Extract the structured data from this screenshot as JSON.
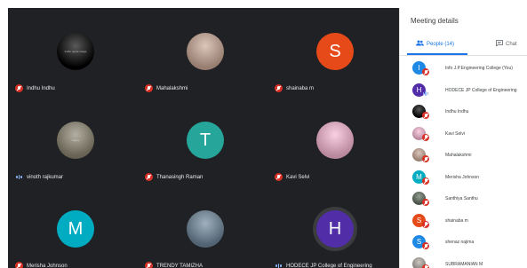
{
  "grid": {
    "tiles": [
      {
        "name": "Indhu Indhu",
        "status": "muted",
        "avatar": {
          "type": "image",
          "bg": "#000000",
          "tiny_text": "Indhu quote image"
        }
      },
      {
        "name": "Mahalakshmi",
        "status": "muted",
        "avatar": {
          "type": "image",
          "bg": "#c9a896"
        }
      },
      {
        "name": "shainaba m",
        "status": "muted",
        "avatar": {
          "type": "letter",
          "letter": "S",
          "bg": "#e64a19"
        }
      },
      {
        "name": "vinoth rajkumar",
        "status": "speaking",
        "avatar": {
          "type": "image",
          "bg": "#8a8470",
          "tiny_text": "Happy"
        }
      },
      {
        "name": "Thanasingh Raman",
        "status": "muted",
        "avatar": {
          "type": "letter",
          "letter": "T",
          "bg": "#26a69a"
        }
      },
      {
        "name": "Kavi Selvi",
        "status": "muted",
        "avatar": {
          "type": "image",
          "bg": "#f7b6d2"
        }
      },
      {
        "name": "Merisha Johnson",
        "status": "muted",
        "avatar": {
          "type": "letter",
          "letter": "M",
          "bg": "#00acc1"
        }
      },
      {
        "name": "TRENDY TAMIZHA",
        "status": "muted",
        "avatar": {
          "type": "image",
          "bg": "#6d8599"
        }
      },
      {
        "name": "HODECE JP College of Engineering",
        "status": "speaking",
        "avatar": {
          "type": "letter",
          "letter": "H",
          "bg": "#512da8"
        }
      }
    ]
  },
  "panel": {
    "title": "Meeting details",
    "tabs": [
      {
        "label": "People (14)",
        "active": true,
        "icon": "people-icon"
      },
      {
        "label": "Chat",
        "active": false,
        "icon": "chat-icon"
      }
    ],
    "people": [
      {
        "name": "Info J.P.Engineering College (You)",
        "status": "muted",
        "avatar": {
          "type": "letter",
          "letter": "I",
          "bg": "#1e88e5"
        }
      },
      {
        "name": "HODECE JP College of Engineering",
        "status": "speaking",
        "avatar": {
          "type": "letter",
          "letter": "H",
          "bg": "#512da8"
        }
      },
      {
        "name": "Indhu Indhu",
        "status": "muted",
        "avatar": {
          "type": "image",
          "bg": "#000000"
        }
      },
      {
        "name": "Kavi Selvi",
        "status": "muted",
        "avatar": {
          "type": "image",
          "bg": "#f7b6d2"
        }
      },
      {
        "name": "Mahalakshmi",
        "status": "muted",
        "avatar": {
          "type": "image",
          "bg": "#c9a896"
        }
      },
      {
        "name": "Merisha Johnson",
        "status": "muted",
        "avatar": {
          "type": "letter",
          "letter": "M",
          "bg": "#00acc1"
        }
      },
      {
        "name": "Santhiya Santhu",
        "status": "muted",
        "avatar": {
          "type": "image",
          "bg": "#5d6b5a"
        }
      },
      {
        "name": "shainaba m",
        "status": "muted",
        "avatar": {
          "type": "letter",
          "letter": "S",
          "bg": "#e64a19"
        }
      },
      {
        "name": "shenaz najima",
        "status": "muted",
        "avatar": {
          "type": "letter",
          "letter": "S",
          "bg": "#1e88e5"
        }
      },
      {
        "name": "SUBRAMANIAN M",
        "status": "muted",
        "avatar": {
          "type": "image",
          "bg": "#b0a9a0"
        }
      }
    ]
  }
}
